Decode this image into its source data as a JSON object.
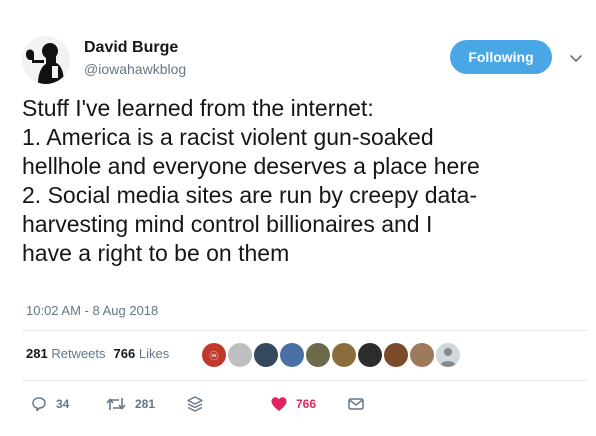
{
  "user": {
    "name": "David Burge",
    "handle": "@iowahawkblog",
    "avatar_icon": "silhouette-portrait"
  },
  "follow_button": {
    "label": "Following",
    "color": "#4aa7e6"
  },
  "tweet": {
    "lines": [
      "Stuff I've learned from the internet:",
      "1. America is a racist violent gun-soaked",
      "hellhole and everyone deserves a place here",
      "2. Social media sites are run by creepy data-",
      "harvesting mind control billionaires and I",
      "have a right to be on them"
    ],
    "timestamp": "10:02 AM - 8 Aug 2018"
  },
  "stats": {
    "retweets_count": "281",
    "retweets_label": "Retweets",
    "likes_count": "766",
    "likes_label": "Likes"
  },
  "liker_avatars": [
    "#c0392b",
    "#bfbfbf",
    "#34495e",
    "#4a6fa5",
    "#6b6b4a",
    "#8a6d3b",
    "#2d2d2d",
    "#7a4a2a",
    "#9c7a5b",
    "#8a8a8a",
    "#cfd8dc"
  ],
  "actions": {
    "reply_count": "34",
    "retweet_count": "281",
    "like_count": "766",
    "like_color": "#e0245e"
  }
}
